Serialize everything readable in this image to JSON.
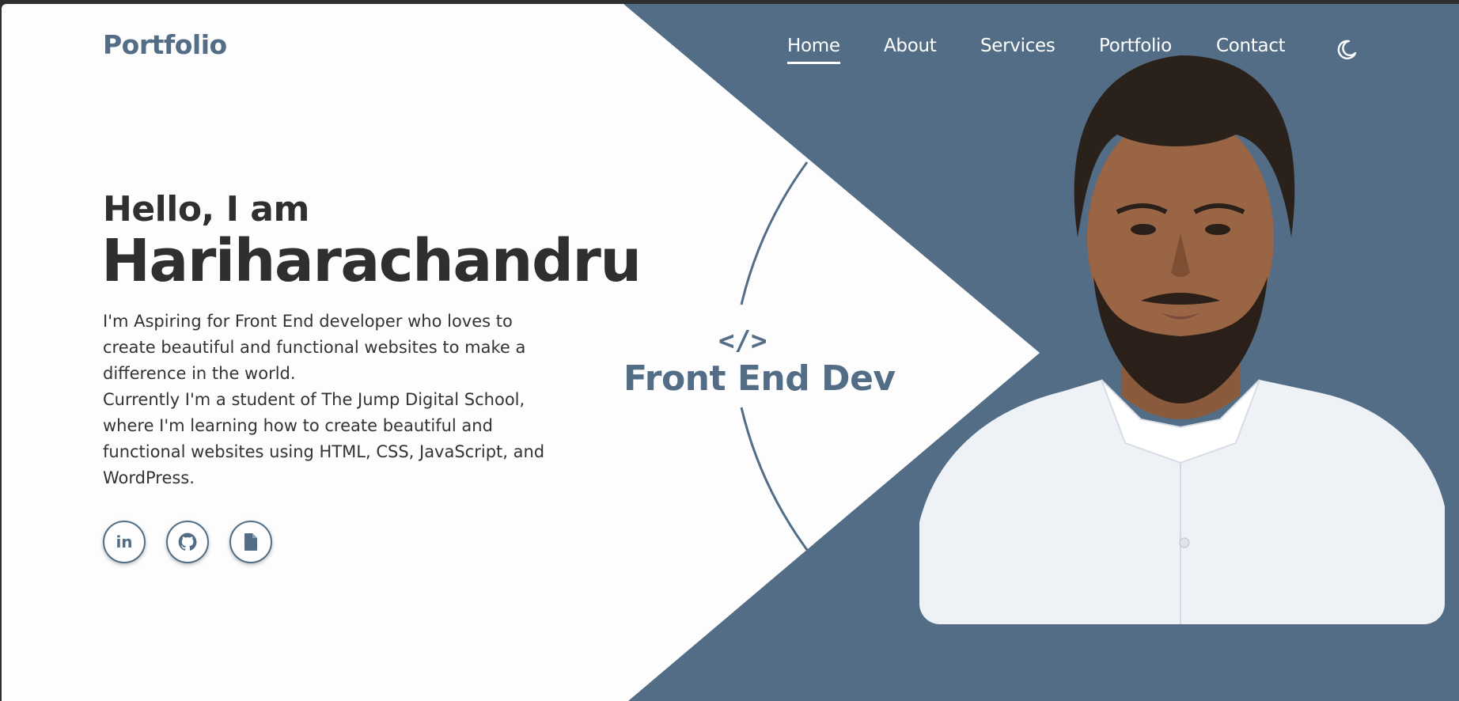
{
  "logo": "Portfolio",
  "nav": {
    "items": [
      {
        "label": "Home",
        "active": true
      },
      {
        "label": "About",
        "active": false
      },
      {
        "label": "Services",
        "active": false
      },
      {
        "label": "Portfolio",
        "active": false
      },
      {
        "label": "Contact",
        "active": false
      }
    ],
    "theme_icon": "moon-icon"
  },
  "hero": {
    "greeting": "Hello, I am",
    "name": "Hariharachandru",
    "bio_line1": "I'm Aspiring for Front End developer who loves to create beautiful and functional websites to make a difference in the world.",
    "bio_line2": "Currently I'm a student of The Jump Digital School, where I'm learning how to create beautiful and functional websites using HTML, CSS, JavaScript, and WordPress.",
    "social": [
      {
        "icon": "linkedin-icon",
        "label": "in"
      },
      {
        "icon": "github-icon"
      },
      {
        "icon": "document-icon"
      }
    ]
  },
  "role": {
    "icon": "</>",
    "title": "Front End Dev"
  },
  "colors": {
    "accent": "#526d85",
    "background": "#fdfdfd",
    "text": "#2f2f2f"
  }
}
